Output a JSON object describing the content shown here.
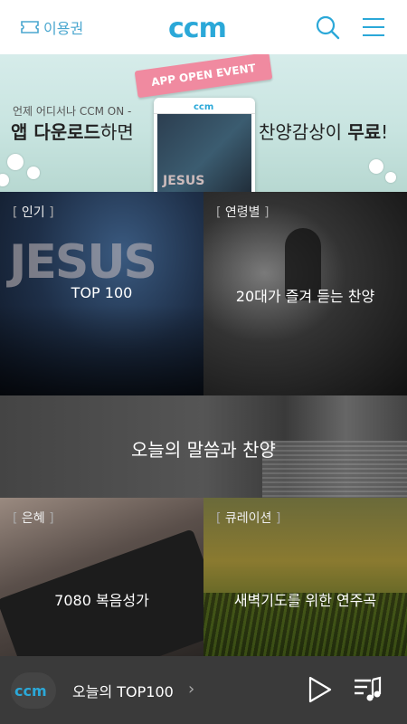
{
  "header": {
    "ticket_label": "이용권",
    "logo_text": "ccm"
  },
  "banner": {
    "event_label": "APP OPEN EVENT",
    "sub_text": "언제 어디서나 CCM ON -",
    "left_bold": "앱 다운로드",
    "left_tail": "하면",
    "right_head": "찬양감상이 ",
    "right_bold": "무료",
    "right_tail": "!",
    "phone_logo": "ccm",
    "phone_image_text": "JESUS"
  },
  "tiles": [
    {
      "tag": "인기",
      "title": "TOP 100",
      "image_text": "JESUS"
    },
    {
      "tag": "연령별",
      "title": "20대가 즐겨 듣는 찬양"
    },
    {
      "tag": "",
      "title": "오늘의 말씀과 찬양"
    },
    {
      "tag": "은혜",
      "title": "7080 복음성가"
    },
    {
      "tag": "큐레이션",
      "title": "새벽기도를 위한 연주곡"
    }
  ],
  "player": {
    "logo_text": "ccm",
    "title": "오늘의 TOP100",
    "chevron": "›"
  },
  "colors": {
    "brand_blue": "#2ba8d8",
    "ribbon_pink": "#f08aa0",
    "player_bg": "#3a3a3a"
  }
}
